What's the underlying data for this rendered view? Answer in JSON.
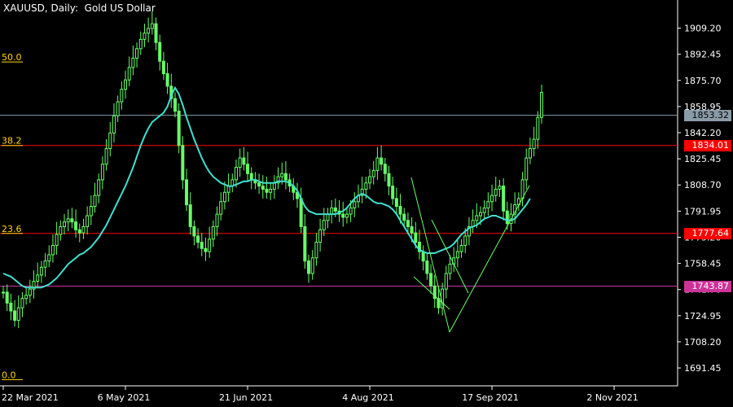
{
  "title": "XAUUSD, Daily:  Gold US Dollar",
  "colors": {
    "background": "#000000",
    "axis": "#ffffff",
    "candle": "#66ff66",
    "ma": "#40e0d0",
    "fib": "#ff0000",
    "fib_label": "#ffd700",
    "pink_level": "#cc3399",
    "gray_level": "#8a9ba8"
  },
  "chart_data": {
    "type": "line",
    "ylim": [
      1680.0,
      1922.0
    ],
    "y_ticks": [
      "1909.20",
      "1892.45",
      "1875.70",
      "1858.95",
      "1842.20",
      "1825.45",
      "1808.70",
      "1791.95",
      "1775.20",
      "1758.45",
      "1741.70",
      "1724.95",
      "1708.20",
      "1691.45"
    ],
    "x_tick_labels": [
      "22 Mar 2021",
      "6 May 2021",
      "21 Jun 2021",
      "4 Aug 2021",
      "17 Sep 2021",
      "2 Nov 2021"
    ],
    "x_tick_index": [
      0,
      32,
      64,
      96,
      128,
      160
    ],
    "price_close": [
      1740,
      1733,
      1728,
      1722,
      1730,
      1736,
      1738,
      1742,
      1747,
      1751,
      1756,
      1760,
      1764,
      1770,
      1777,
      1782,
      1785,
      1787,
      1785,
      1780,
      1778,
      1782,
      1789,
      1795,
      1802,
      1812,
      1822,
      1832,
      1842,
      1853,
      1862,
      1870,
      1876,
      1884,
      1890,
      1896,
      1902,
      1906,
      1909,
      1912,
      1900,
      1888,
      1880,
      1872,
      1864,
      1856,
      1834,
      1812,
      1796,
      1782,
      1776,
      1772,
      1768,
      1766,
      1774,
      1782,
      1790,
      1798,
      1804,
      1808,
      1812,
      1820,
      1826,
      1822,
      1816,
      1812,
      1810,
      1808,
      1806,
      1804,
      1806,
      1810,
      1814,
      1816,
      1812,
      1808,
      1804,
      1800,
      1782,
      1760,
      1752,
      1762,
      1772,
      1780,
      1786,
      1790,
      1794,
      1792,
      1790,
      1788,
      1790,
      1794,
      1798,
      1802,
      1806,
      1810,
      1814,
      1818,
      1826,
      1822,
      1816,
      1808,
      1800,
      1795,
      1790,
      1786,
      1782,
      1778,
      1772,
      1766,
      1760,
      1752,
      1744,
      1736,
      1730,
      1742,
      1752,
      1758,
      1762,
      1766,
      1770,
      1776,
      1782,
      1786,
      1789,
      1791,
      1794,
      1798,
      1802,
      1806,
      1808,
      1792,
      1784,
      1790,
      1796,
      1800,
      1812,
      1826,
      1832,
      1838,
      1852,
      1868
    ],
    "ma_values": [
      1752,
      1751,
      1750,
      1748,
      1746,
      1744,
      1743,
      1743,
      1743,
      1743,
      1743,
      1744,
      1745,
      1747,
      1749,
      1752,
      1755,
      1758,
      1760,
      1762,
      1764,
      1765,
      1767,
      1769,
      1772,
      1775,
      1779,
      1783,
      1788,
      1793,
      1798,
      1803,
      1808,
      1814,
      1820,
      1827,
      1834,
      1840,
      1845,
      1849,
      1851,
      1853,
      1855,
      1859,
      1866,
      1871,
      1867,
      1860,
      1852,
      1845,
      1838,
      1832,
      1826,
      1821,
      1817,
      1814,
      1812,
      1810,
      1809,
      1808,
      1808,
      1809,
      1810,
      1811,
      1811,
      1812,
      1812,
      1811,
      1810,
      1810,
      1810,
      1810,
      1811,
      1811,
      1811,
      1810,
      1808,
      1805,
      1800,
      1795,
      1792,
      1791,
      1790,
      1790,
      1790,
      1790,
      1790,
      1790,
      1791,
      1792,
      1794,
      1797,
      1800,
      1802,
      1803,
      1802,
      1800,
      1798,
      1797,
      1797,
      1796,
      1795,
      1793,
      1790,
      1786,
      1782,
      1778,
      1774,
      1770,
      1767,
      1766,
      1765,
      1765,
      1765,
      1766,
      1767,
      1768,
      1769,
      1771,
      1774,
      1777,
      1779,
      1781,
      1782,
      1783,
      1785,
      1787,
      1788,
      1789,
      1789,
      1788,
      1787,
      1786,
      1786,
      1787,
      1790,
      1793,
      1796,
      1800
    ],
    "fib_levels": [
      {
        "label": "50.0",
        "value": 1887.5
      },
      {
        "label": "38.2",
        "value": 1834.01
      },
      {
        "label": "23.6",
        "value": 1777.64
      },
      {
        "label": "0.0",
        "value": 1684.0
      }
    ],
    "price_labels": [
      {
        "text": "1853.32",
        "value": 1853.32,
        "kind": "gray"
      },
      {
        "text": "1834.01",
        "value": 1834.01,
        "kind": "red"
      },
      {
        "text": "1777.64",
        "value": 1777.64,
        "kind": "red"
      },
      {
        "text": "1743.87",
        "value": 1743.87,
        "kind": "pink"
      }
    ]
  }
}
